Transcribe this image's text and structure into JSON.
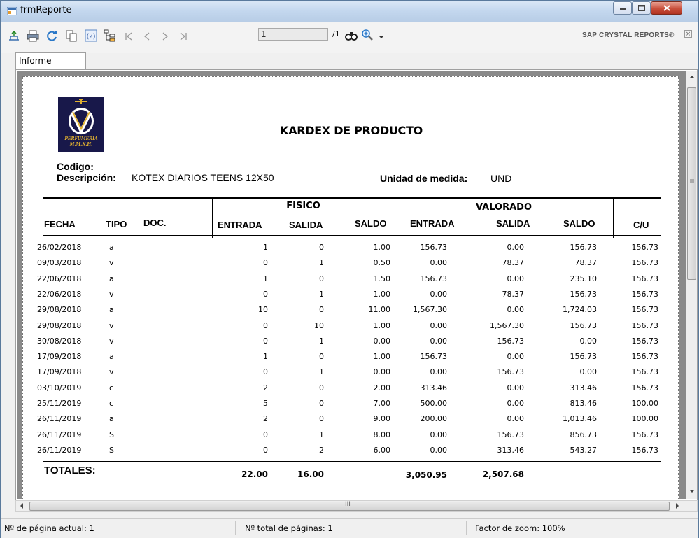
{
  "window": {
    "title": "frmReporte"
  },
  "toolbar": {
    "page_input": "1",
    "page_of": "/1",
    "brand": "SAP CRYSTAL REPORTS®"
  },
  "tabs": [
    {
      "label": "Informe principal"
    }
  ],
  "report": {
    "logo_text": "PERFUMERÍA\nM.M.K.H.",
    "title": "KARDEX DE PRODUCTO",
    "codigo_label": "Codigo:",
    "descripcion_label": "Descripción:",
    "descripcion_value": "KOTEX DIARIOS TEENS 12X50",
    "unidad_label": "Unidad de medida:",
    "unidad_value": "UND",
    "group_headers": {
      "fisico": "FISICO",
      "valorado": "VALORADO"
    },
    "columns": [
      "FECHA",
      "TIPO",
      "DOC.",
      "ENTRADA",
      "SALIDA",
      "SALDO",
      "ENTRADA",
      "SALIDA",
      "SALDO",
      "C/U"
    ],
    "rows": [
      {
        "fecha": "26/02/2018",
        "tipo": "a",
        "f_entrada": "1",
        "f_salida": "0",
        "f_saldo": "1.00",
        "v_entrada": "156.73",
        "v_salida": "0.00",
        "v_saldo": "156.73",
        "cu": "156.73"
      },
      {
        "fecha": "09/03/2018",
        "tipo": "v",
        "f_entrada": "0",
        "f_salida": "1",
        "f_saldo": "0.50",
        "v_entrada": "0.00",
        "v_salida": "78.37",
        "v_saldo": "78.37",
        "cu": "156.73"
      },
      {
        "fecha": "22/06/2018",
        "tipo": "a",
        "f_entrada": "1",
        "f_salida": "0",
        "f_saldo": "1.50",
        "v_entrada": "156.73",
        "v_salida": "0.00",
        "v_saldo": "235.10",
        "cu": "156.73"
      },
      {
        "fecha": "22/06/2018",
        "tipo": "v",
        "f_entrada": "0",
        "f_salida": "1",
        "f_saldo": "1.00",
        "v_entrada": "0.00",
        "v_salida": "78.37",
        "v_saldo": "156.73",
        "cu": "156.73"
      },
      {
        "fecha": "29/08/2018",
        "tipo": "a",
        "f_entrada": "10",
        "f_salida": "0",
        "f_saldo": "11.00",
        "v_entrada": "1,567.30",
        "v_salida": "0.00",
        "v_saldo": "1,724.03",
        "cu": "156.73"
      },
      {
        "fecha": "29/08/2018",
        "tipo": "v",
        "f_entrada": "0",
        "f_salida": "10",
        "f_saldo": "1.00",
        "v_entrada": "0.00",
        "v_salida": "1,567.30",
        "v_saldo": "156.73",
        "cu": "156.73"
      },
      {
        "fecha": "30/08/2018",
        "tipo": "v",
        "f_entrada": "0",
        "f_salida": "1",
        "f_saldo": "0.00",
        "v_entrada": "0.00",
        "v_salida": "156.73",
        "v_saldo": "0.00",
        "cu": "156.73"
      },
      {
        "fecha": "17/09/2018",
        "tipo": "a",
        "f_entrada": "1",
        "f_salida": "0",
        "f_saldo": "1.00",
        "v_entrada": "156.73",
        "v_salida": "0.00",
        "v_saldo": "156.73",
        "cu": "156.73"
      },
      {
        "fecha": "17/09/2018",
        "tipo": "v",
        "f_entrada": "0",
        "f_salida": "1",
        "f_saldo": "0.00",
        "v_entrada": "0.00",
        "v_salida": "156.73",
        "v_saldo": "0.00",
        "cu": "156.73"
      },
      {
        "fecha": "03/10/2019",
        "tipo": "c",
        "f_entrada": "2",
        "f_salida": "0",
        "f_saldo": "2.00",
        "v_entrada": "313.46",
        "v_salida": "0.00",
        "v_saldo": "313.46",
        "cu": "156.73"
      },
      {
        "fecha": "25/11/2019",
        "tipo": "c",
        "f_entrada": "5",
        "f_salida": "0",
        "f_saldo": "7.00",
        "v_entrada": "500.00",
        "v_salida": "0.00",
        "v_saldo": "813.46",
        "cu": "100.00"
      },
      {
        "fecha": "26/11/2019",
        "tipo": "a",
        "f_entrada": "2",
        "f_salida": "0",
        "f_saldo": "9.00",
        "v_entrada": "200.00",
        "v_salida": "0.00",
        "v_saldo": "1,013.46",
        "cu": "100.00"
      },
      {
        "fecha": "26/11/2019",
        "tipo": "S",
        "f_entrada": "0",
        "f_salida": "1",
        "f_saldo": "8.00",
        "v_entrada": "0.00",
        "v_salida": "156.73",
        "v_saldo": "856.73",
        "cu": "156.73"
      },
      {
        "fecha": "26/11/2019",
        "tipo": "S",
        "f_entrada": "0",
        "f_salida": "2",
        "f_saldo": "6.00",
        "v_entrada": "0.00",
        "v_salida": "313.46",
        "v_saldo": "543.27",
        "cu": "156.73"
      }
    ],
    "totals": {
      "label": "TOTALES:",
      "f_entrada": "22.00",
      "f_salida": "16.00",
      "v_entrada": "3,050.95",
      "v_salida": "2,507.68"
    }
  },
  "hscroll_label": "III",
  "status": {
    "current_page": "Nº de página actual: 1",
    "total_pages": "Nº total de páginas: 1",
    "zoom": "Factor de zoom: 100%"
  }
}
